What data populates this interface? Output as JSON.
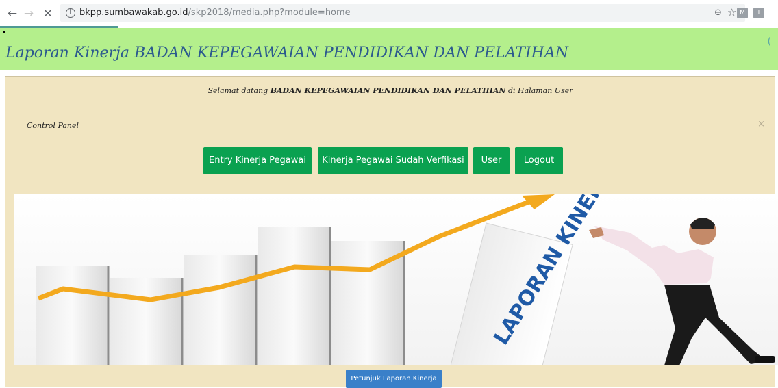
{
  "browser": {
    "url_host": "bkpp.sumbawakab.go.id",
    "url_path": "/skp2018/media.php?module=home",
    "extensions": [
      "M",
      "I"
    ]
  },
  "header": {
    "title": "Laporan Kinerja BADAN KEPEGAWAIAN PENDIDIKAN DAN PELATIHAN"
  },
  "welcome": {
    "prefix": "Selamat datang ",
    "org": "BADAN KEPEGAWAIAN PENDIDIKAN DAN PELATIHAN",
    "suffix": " di Halaman User"
  },
  "control_panel": {
    "title": "Control Panel",
    "close": "×",
    "buttons": {
      "entry": "Entry Kinerja Pegawai",
      "verified": "Kinerja Pegawai Sudah Verfikasi",
      "user": "User",
      "logout": "Logout"
    }
  },
  "banner": {
    "block_text": "LAPORAN KINERJA"
  },
  "guide_button": "Petunjuk Laporan Kinerja",
  "colors": {
    "header_bg": "#b4ef8c",
    "content_bg": "#f1e5c1",
    "button_green": "#0aa150",
    "button_blue": "#3a80c9"
  }
}
